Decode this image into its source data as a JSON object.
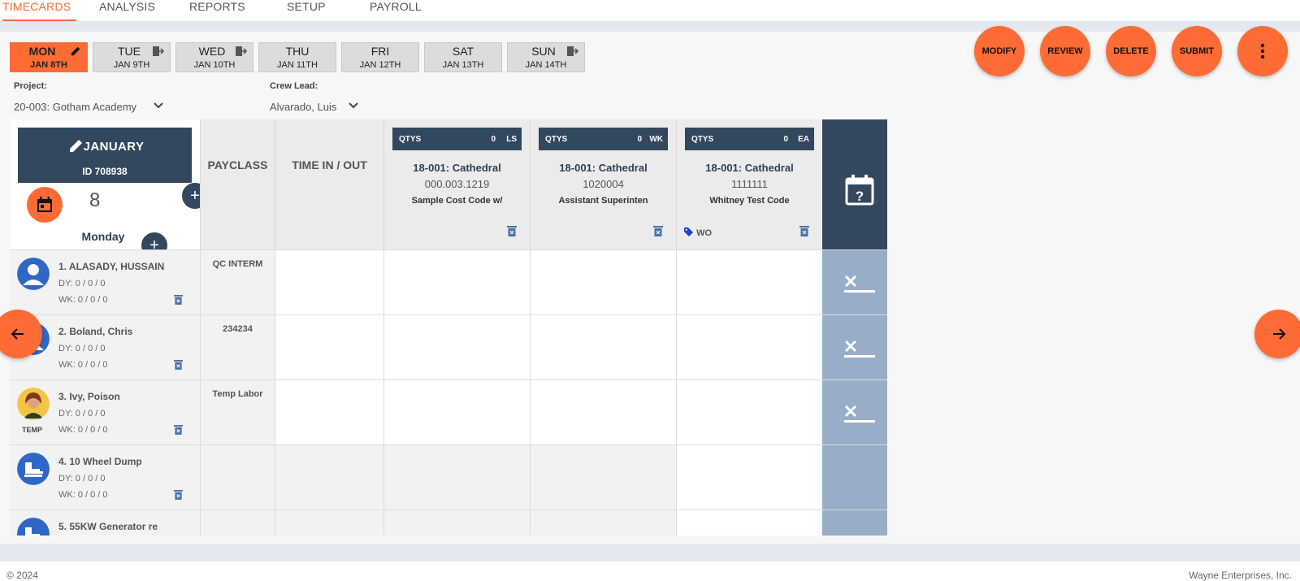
{
  "nav": {
    "tabs": [
      {
        "label": "TIMECARDS",
        "active": true
      },
      {
        "label": "ANALYSIS"
      },
      {
        "label": "REPORTS"
      },
      {
        "label": "SETUP"
      },
      {
        "label": "PAYROLL"
      }
    ]
  },
  "days": [
    {
      "name": "MON",
      "date": "JAN 8TH",
      "active": true,
      "icon": "pencil-icon"
    },
    {
      "name": "TUE",
      "date": "JAN 9TH",
      "icon": "copy-day-icon"
    },
    {
      "name": "WED",
      "date": "JAN 10TH",
      "icon": "copy-day-icon"
    },
    {
      "name": "THU",
      "date": "JAN 11TH"
    },
    {
      "name": "FRI",
      "date": "JAN 12TH"
    },
    {
      "name": "SAT",
      "date": "JAN 13TH"
    },
    {
      "name": "SUN",
      "date": "JAN 14TH",
      "icon": "copy-day-icon"
    }
  ],
  "actions": {
    "modify": "MODIFY",
    "review": "REVIEW",
    "delete": "DELETE",
    "submit": "SUBMIT",
    "more_icon": "more-vertical-icon"
  },
  "filters": {
    "project_label": "Project:",
    "project_value": "20-003: Gotham Academy",
    "crew_label": "Crew Lead:",
    "crew_value": "Alvarado, Luis"
  },
  "timecard": {
    "month": "JANUARY",
    "id": "ID 708938",
    "day_number": "8",
    "day_name": "Monday"
  },
  "headers": {
    "payclass": "PAYCLASS",
    "time": "TIME IN / OUT"
  },
  "cost_codes": [
    {
      "qtys": "QTYS",
      "count": "0",
      "unit": "LS",
      "title": "18-001: Cathedral",
      "code": "000.003.1219",
      "desc": "Sample Cost Code w/",
      "tag": ""
    },
    {
      "qtys": "QTYS",
      "count": "0",
      "unit": "WK",
      "title": "18-001: Cathedral",
      "code": "1020004",
      "desc": "Assistant Superinten",
      "tag": ""
    },
    {
      "qtys": "QTYS",
      "count": "0",
      "unit": "EA",
      "title": "18-001: Cathedral",
      "code": "1111111",
      "desc": "Whitney Test Code",
      "tag": "WO"
    }
  ],
  "employees": [
    {
      "name": "1. ALASADY, HUSSAIN",
      "dy": "DY: 0 / 0 / 0",
      "wk": "WK: 0 / 0 / 0",
      "payclass": "QC INTERM",
      "avatar": "person-avatar-icon",
      "temp": ""
    },
    {
      "name": "2. Boland, Chris",
      "dy": "DY: 0 / 0 / 0",
      "wk": "WK: 0 / 0 / 0",
      "payclass": "234234",
      "avatar": "person-avatar-icon",
      "temp": ""
    },
    {
      "name": "3. Ivy, Poison",
      "dy": "DY: 0 / 0 / 0",
      "wk": "WK: 0 / 0 / 0",
      "payclass": "Temp Labor",
      "avatar": "photo-avatar",
      "temp": "TEMP"
    },
    {
      "name": "4. 10 Wheel Dump",
      "dy": "DY: 0 / 0 / 0",
      "wk": "WK: 0 / 0 / 0",
      "payclass": "",
      "avatar": "equipment-icon",
      "temp": ""
    },
    {
      "name": "5. 55KW Generator re",
      "dy": "",
      "wk": "",
      "payclass": "",
      "avatar": "equipment-icon",
      "temp": ""
    }
  ],
  "footer": {
    "copyright": "© 2024",
    "company": "Wayne Enterprises, Inc."
  },
  "colors": {
    "accent": "#ff6b35",
    "navy": "#33475e",
    "tail_blue": "#98adc7"
  }
}
